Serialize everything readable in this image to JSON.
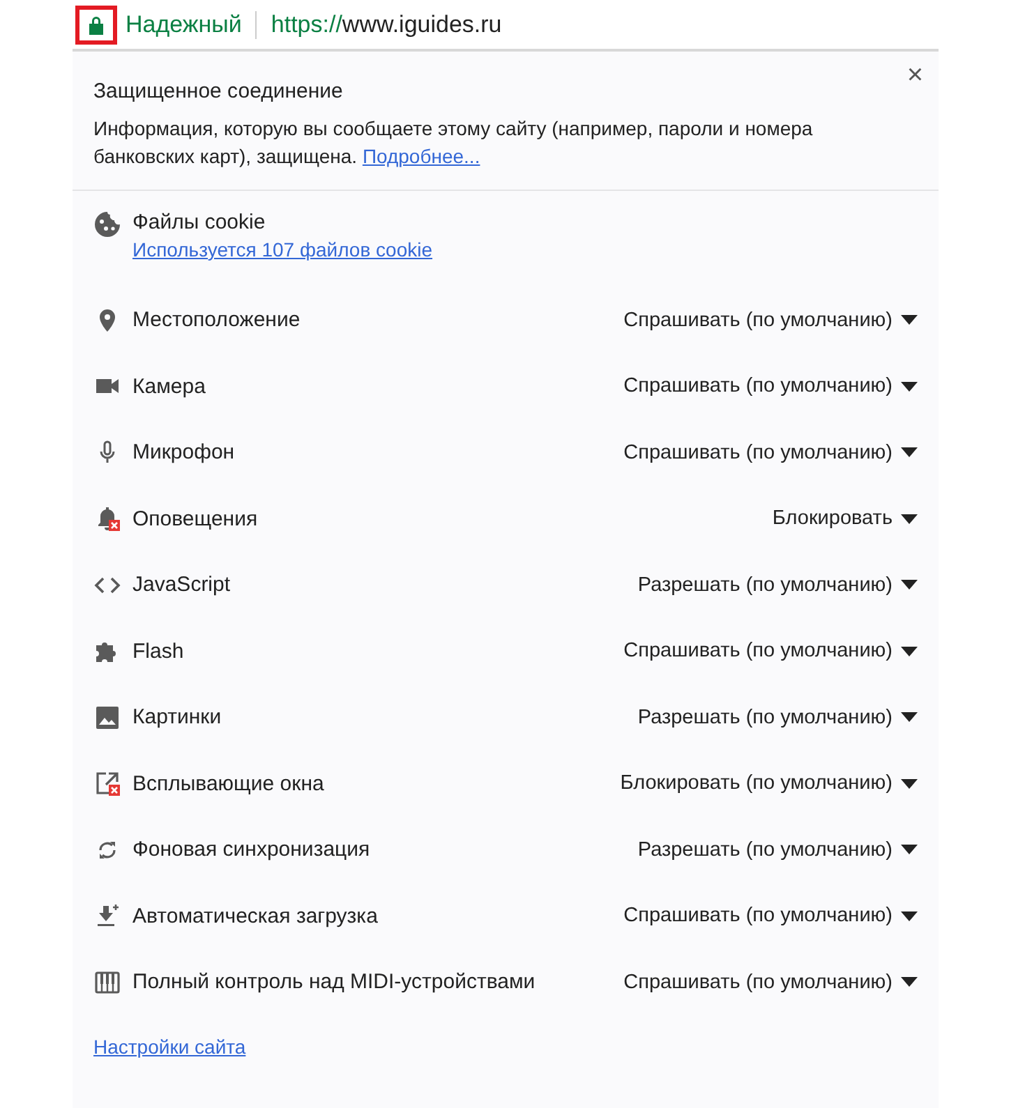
{
  "address_bar": {
    "security_label": "Надежный",
    "url_scheme": "https://",
    "url_host": "www.iguides.ru",
    "highlighted": true
  },
  "popup": {
    "close": "×",
    "title": "Защищенное соединение",
    "description": "Информация, которую вы сообщаете этому сайту (например, пароли и номера банковских карт), защищена.",
    "details_link": "Подробнее...",
    "cookies": {
      "label": "Файлы cookie",
      "link": "Используется 107 файлов cookie"
    },
    "permissions": [
      {
        "kind": "location",
        "label": "Местоположение",
        "setting": "Спрашивать (по умолчанию)"
      },
      {
        "kind": "camera",
        "label": "Камера",
        "setting": "Спрашивать (по умолчанию)"
      },
      {
        "kind": "microphone",
        "label": "Микрофон",
        "setting": "Спрашивать (по умолчанию)"
      },
      {
        "kind": "notifications",
        "label": "Оповещения",
        "setting": "Блокировать"
      },
      {
        "kind": "code",
        "label": "JavaScript",
        "setting": "Разрешать (по умолчанию)"
      },
      {
        "kind": "puzzle",
        "label": "Flash",
        "setting": "Спрашивать (по умолчанию)"
      },
      {
        "kind": "image",
        "label": "Картинки",
        "setting": "Разрешать (по умолчанию)"
      },
      {
        "kind": "popup",
        "label": "Всплывающие окна",
        "setting": "Блокировать (по умолчанию)"
      },
      {
        "kind": "sync",
        "label": "Фоновая синхронизация",
        "setting": "Разрешать (по умолчанию)"
      },
      {
        "kind": "download",
        "label": "Автоматическая загрузка",
        "setting": "Спрашивать (по умолчанию)"
      },
      {
        "kind": "piano",
        "label": "Полный контроль над MIDI-устройствами",
        "setting": "Спрашивать (по умолчанию)"
      }
    ],
    "site_settings_link": "Настройки сайта"
  }
}
